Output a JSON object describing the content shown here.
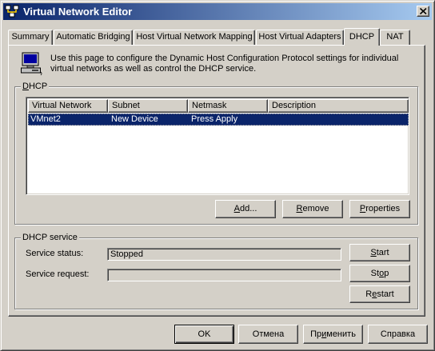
{
  "window": {
    "title": "Virtual Network Editor",
    "icon": "network-editor-icon"
  },
  "tabs": [
    {
      "label": "Summary",
      "active": false
    },
    {
      "label": "Automatic Bridging",
      "active": false
    },
    {
      "label": "Host Virtual Network Mapping",
      "active": false
    },
    {
      "label": "Host Virtual Adapters",
      "active": false
    },
    {
      "label": "DHCP",
      "active": true
    },
    {
      "label": "NAT",
      "active": false
    }
  ],
  "info": {
    "icon": "computer-icon",
    "text": "Use this page to configure the Dynamic Host Configuration Protocol settings for individual virtual networks as well as control the DHCP service."
  },
  "dhcp_group": {
    "label_prefix": "",
    "label_accel": "D",
    "label_rest": "HCP",
    "columns": [
      "Virtual Network",
      "Subnet",
      "Netmask",
      "Description"
    ],
    "rows": [
      {
        "network": "VMnet2",
        "subnet": "New Device",
        "netmask": "Press Apply",
        "description": "",
        "selected": true
      }
    ],
    "buttons": {
      "add": {
        "accel": "A",
        "rest": "dd..."
      },
      "remove": {
        "accel": "R",
        "rest": "emove"
      },
      "properties": {
        "accel": "P",
        "rest": "roperties"
      }
    }
  },
  "service_group": {
    "label": "DHCP service",
    "status_label": "Service status:",
    "status_value": "Stopped",
    "request_label": "Service request:",
    "request_value": "",
    "buttons": {
      "start": {
        "accel": "S",
        "rest": "tart"
      },
      "stop": {
        "pre": "St",
        "accel": "o",
        "rest": "p"
      },
      "restart": {
        "pre": "R",
        "accel": "e",
        "rest": "start"
      }
    }
  },
  "footer": {
    "ok": "OK",
    "cancel": "Отмена",
    "apply_pre": "Пр",
    "apply_accel": "и",
    "apply_rest": "менить",
    "help": "Справка"
  },
  "colors": {
    "face": "#d4d0c8",
    "titlebar_start": "#0a246a",
    "titlebar_end": "#a6caf0",
    "selection": "#0a246a"
  }
}
